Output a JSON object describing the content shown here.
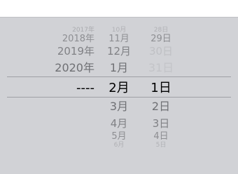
{
  "picker": {
    "years": [
      {
        "label": "2017年",
        "color": "#a9aaae"
      },
      {
        "label": "2018年",
        "color": "#8d8e92"
      },
      {
        "label": "2019年",
        "color": "#808185"
      },
      {
        "label": "2020年",
        "color": "#6f7074"
      },
      {
        "label": "----",
        "color": "#000000"
      }
    ],
    "months": [
      {
        "label": "10月",
        "color": "#b0b1b5"
      },
      {
        "label": "11月",
        "color": "#8d8e92"
      },
      {
        "label": "12月",
        "color": "#808185"
      },
      {
        "label": "1月",
        "color": "#6f7074"
      },
      {
        "label": "2月",
        "color": "#000000"
      },
      {
        "label": "3月",
        "color": "#6f7074"
      },
      {
        "label": "4月",
        "color": "#808185"
      },
      {
        "label": "5月",
        "color": "#8d8e92"
      },
      {
        "label": "6月",
        "color": "#b0b1b5"
      }
    ],
    "days": [
      {
        "label": "28日",
        "color": "#b0b1b5"
      },
      {
        "label": "29日",
        "color": "#8d8e92"
      },
      {
        "label": "30日",
        "color": "#bfc0c4"
      },
      {
        "label": "31日",
        "color": "#c3c4c8"
      },
      {
        "label": "1日",
        "color": "#000000"
      },
      {
        "label": "2日",
        "color": "#6f7074"
      },
      {
        "label": "3日",
        "color": "#808185"
      },
      {
        "label": "4日",
        "color": "#8d8e92"
      },
      {
        "label": "5日",
        "color": "#b0b1b5"
      }
    ]
  }
}
